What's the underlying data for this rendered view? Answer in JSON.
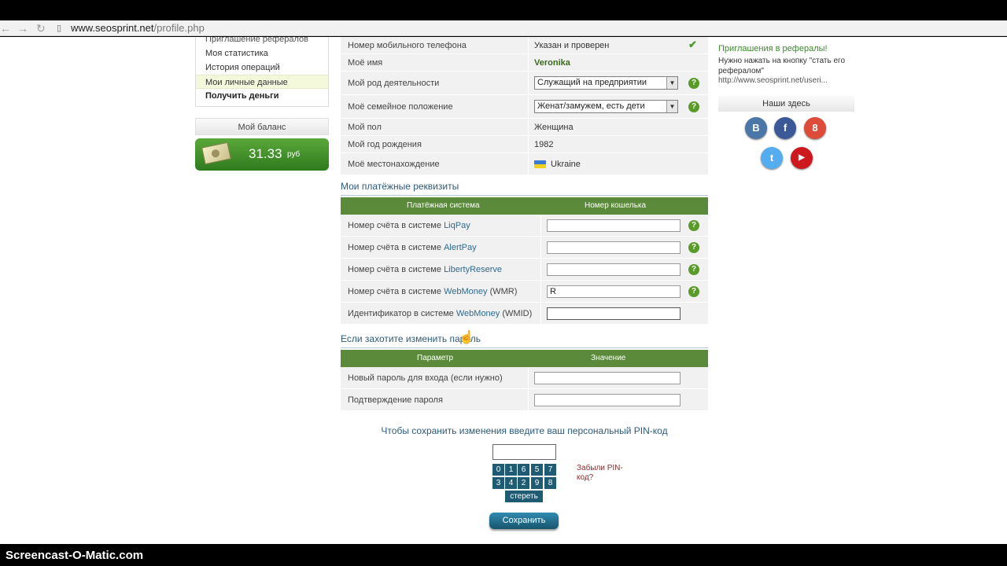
{
  "browser": {
    "url_host": "www.seosprint.net",
    "url_path": "/profile.php"
  },
  "left_menu": {
    "items": [
      {
        "label": "Приглашение рефералов"
      },
      {
        "label": "Моя статистика"
      },
      {
        "label": "История операций"
      },
      {
        "label": "Мои личные данные"
      },
      {
        "label": "Получить деньги"
      }
    ]
  },
  "balance": {
    "title": "Мой баланс",
    "amount": "31.33",
    "currency": "руб"
  },
  "profile": {
    "rows": [
      {
        "label": "Номер мобильного телефона",
        "value": "Указан и проверен"
      },
      {
        "label": "Моё имя",
        "value": "Veronika"
      },
      {
        "label": "Мой род деятельности",
        "value": "Служащий на предприятии"
      },
      {
        "label": "Моё семейное положение",
        "value": "Женат/замужем, есть дети"
      },
      {
        "label": "Мой пол",
        "value": "Женщина"
      },
      {
        "label": "Мой год рождения",
        "value": "1982"
      },
      {
        "label": "Моё местонахождение",
        "value": "Ukraine"
      }
    ]
  },
  "payments": {
    "title": "Мои платёжные реквизиты",
    "col1": "Платёжная система",
    "col2": "Номер кошелька",
    "rows": [
      {
        "prefix": "Номер счёта в системе",
        "system": "LiqPay",
        "suffix": "",
        "value": ""
      },
      {
        "prefix": "Номер счёта в системе",
        "system": "AlertPay",
        "suffix": "",
        "value": ""
      },
      {
        "prefix": "Номер счёта в системе",
        "system": "LibertyReserve",
        "suffix": "",
        "value": ""
      },
      {
        "prefix": "Номер счёта в системе",
        "system": "WebMoney",
        "suffix": "(WMR)",
        "value": "R"
      },
      {
        "prefix": "Идентификатор в системе",
        "system": "WebMoney",
        "suffix": "(WMID)",
        "value": ""
      }
    ]
  },
  "password": {
    "title": "Если захотите изменить пароль",
    "col1": "Параметр",
    "col2": "Значение",
    "rows": [
      {
        "label": "Новый пароль для входа (если нужно)"
      },
      {
        "label": "Подтверждение пароля"
      }
    ]
  },
  "pin": {
    "title": "Чтобы сохранить изменения введите ваш персональный PIN-код",
    "keys": [
      "0",
      "1",
      "6",
      "5",
      "7",
      "3",
      "4",
      "2",
      "9",
      "8"
    ],
    "erase": "стереть",
    "forgot": "Забыли PIN-код?",
    "save": "Сохранить"
  },
  "sidebar_right": {
    "ref_link": "Приглашения в рефералы!",
    "ref_text": "Нужно нажать на кнопку \"стать его рефералом\"",
    "ref_url": "http://www.seosprint.net/useri...",
    "here_title": "Наши здесь",
    "social": [
      {
        "letter": "В",
        "name": "vkontakte",
        "color": "#4a76a8"
      },
      {
        "letter": "f",
        "name": "facebook",
        "color": "#3b5998"
      },
      {
        "letter": "8",
        "name": "google",
        "color": "#dd4b39"
      },
      {
        "letter": "t",
        "name": "twitter",
        "color": "#55acee"
      },
      {
        "letter": "▶",
        "name": "youtube",
        "color": "#cc181e"
      }
    ]
  },
  "watermark": "Screencast-O-Matic.com",
  "colors": {
    "green_header": "#5b8a3a",
    "pin_key": "#1f5c74",
    "balance_green": "#3f8e28"
  }
}
